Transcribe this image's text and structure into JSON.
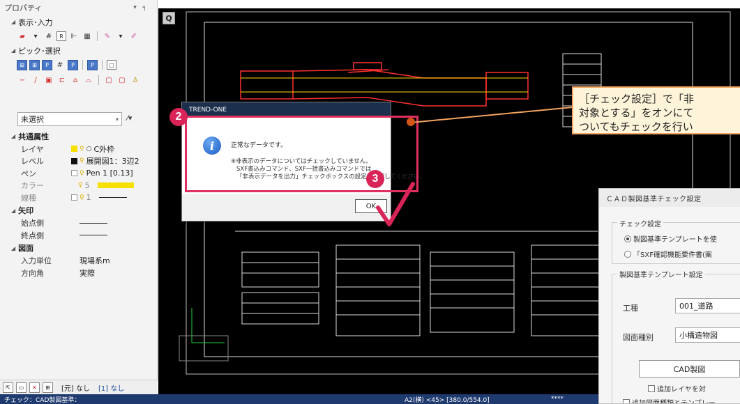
{
  "panel": {
    "title": "プロパティ",
    "title_controls": "▾ ╕",
    "section_display": "表示･入力",
    "section_pick": "ピック･選択",
    "select_value": "未選択",
    "common_header": "共通属性",
    "props": [
      {
        "key": "レイヤ",
        "value": "C外枠"
      },
      {
        "key": "レベル",
        "value": "展開図1：3辺2"
      },
      {
        "key": "ペン",
        "value": "Pen 1 [0.13]"
      },
      {
        "key": "カラー",
        "value": "5"
      },
      {
        "key": "線種",
        "value": "1"
      }
    ],
    "arrow_header": "矢印",
    "arrow_props": [
      {
        "key": "始点側"
      },
      {
        "key": "終点側"
      }
    ],
    "sheet_header": "図面",
    "sheet_props": [
      {
        "key": "入力単位",
        "value": "現場系m"
      },
      {
        "key": "方向角",
        "value": "実際"
      }
    ],
    "bottom_left": "[元] なし",
    "bottom_right": "[1] なし"
  },
  "status": {
    "left": "チェック：CAD製図基準：",
    "mid": "A2(横)  <45>  [380.0/554.0]",
    "right": "****"
  },
  "dialog": {
    "title": "TREND-ONE",
    "message": "正常なデータです。",
    "note_lines": [
      "※非表示のデータについてはチェックしていません。",
      "SXF書込みコマンド、SXF一括書込みコマンドでは",
      "「非表示データを出力」チェックボックスの設定を確認してください。"
    ],
    "ok": "OK"
  },
  "steps": {
    "two": "2",
    "three": "3"
  },
  "callout": {
    "line1": "［チェック設定］で「非",
    "line2": "対象とする」をオンにて",
    "line3": "ついてもチェックを行い"
  },
  "cad_dialog": {
    "title": "ＣＡＤ製図基準チェック設定",
    "check_group": "チェック設定",
    "radio1": "製図基準テンプレートを使",
    "radio2": "「SXF確認機能要件書(案",
    "template_group": "製図基準テンプレート設定",
    "kind_label": "工種",
    "kind_value": "001_道路",
    "type_label": "図面種別",
    "type_value": "小構造物図",
    "button": "CAD製図",
    "check1": "追加レイヤを対",
    "check2": "追加図面種類とテンプレー"
  },
  "canvas": {
    "button": "Q"
  },
  "colors": {
    "accent": "#d92458",
    "callout_border": "#f4a460",
    "status": "#1e3a6e"
  }
}
